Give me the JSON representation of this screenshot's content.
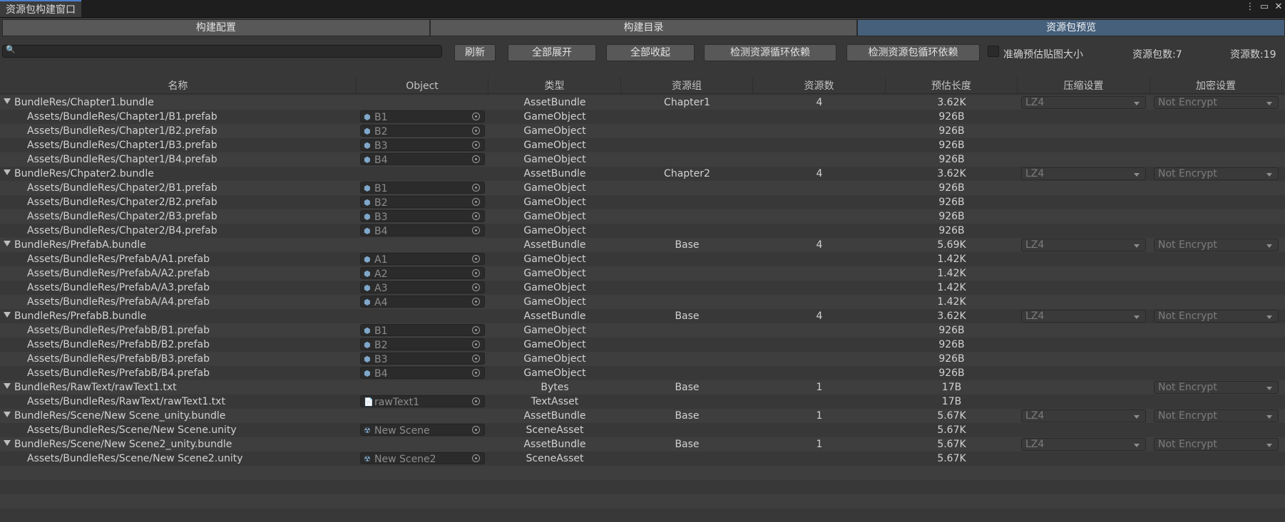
{
  "window": {
    "title": "资源包构建窗口"
  },
  "tabs": [
    {
      "label": "构建配置",
      "active": false
    },
    {
      "label": "构建目录",
      "active": false
    },
    {
      "label": "资源包预览",
      "active": true
    }
  ],
  "toolbar": {
    "search_placeholder": "",
    "refresh": "刷新",
    "expand_all": "全部展开",
    "collapse_all": "全部收起",
    "check_asset_cycle": "检测资源循环依赖",
    "check_bundle_cycle": "检测资源包循环依赖",
    "accurate_texture_size": "准确预估贴图大小",
    "bundle_count": "资源包数:7",
    "asset_count": "资源数:19"
  },
  "columns": {
    "name": "名称",
    "object": "Object",
    "type": "类型",
    "group": "资源组",
    "asset_count": "资源数",
    "size": "预估长度",
    "compression": "压缩设置",
    "encryption": "加密设置"
  },
  "rows": [
    {
      "kind": "bundle",
      "name": "BundleRes/Chapter1.bundle",
      "type": "AssetBundle",
      "group": "Chapter1",
      "count": "4",
      "size": "3.62K",
      "compression": "LZ4",
      "encryption": "Not Encrypt"
    },
    {
      "kind": "asset",
      "name": "Assets/BundleRes/Chapter1/B1.prefab",
      "obj": "B1",
      "obj_icon": "prefab-icon",
      "type": "GameObject",
      "size": "926B"
    },
    {
      "kind": "asset",
      "name": "Assets/BundleRes/Chapter1/B2.prefab",
      "obj": "B2",
      "obj_icon": "prefab-icon",
      "type": "GameObject",
      "size": "926B"
    },
    {
      "kind": "asset",
      "name": "Assets/BundleRes/Chapter1/B3.prefab",
      "obj": "B3",
      "obj_icon": "prefab-icon",
      "type": "GameObject",
      "size": "926B"
    },
    {
      "kind": "asset",
      "name": "Assets/BundleRes/Chapter1/B4.prefab",
      "obj": "B4",
      "obj_icon": "prefab-icon",
      "type": "GameObject",
      "size": "926B"
    },
    {
      "kind": "bundle",
      "name": "BundleRes/Chpater2.bundle",
      "type": "AssetBundle",
      "group": "Chapter2",
      "count": "4",
      "size": "3.62K",
      "compression": "LZ4",
      "encryption": "Not Encrypt"
    },
    {
      "kind": "asset",
      "name": "Assets/BundleRes/Chpater2/B1.prefab",
      "obj": "B1",
      "obj_icon": "prefab-icon",
      "type": "GameObject",
      "size": "926B"
    },
    {
      "kind": "asset",
      "name": "Assets/BundleRes/Chpater2/B2.prefab",
      "obj": "B2",
      "obj_icon": "prefab-icon",
      "type": "GameObject",
      "size": "926B"
    },
    {
      "kind": "asset",
      "name": "Assets/BundleRes/Chpater2/B3.prefab",
      "obj": "B3",
      "obj_icon": "prefab-icon",
      "type": "GameObject",
      "size": "926B"
    },
    {
      "kind": "asset",
      "name": "Assets/BundleRes/Chpater2/B4.prefab",
      "obj": "B4",
      "obj_icon": "prefab-icon",
      "type": "GameObject",
      "size": "926B"
    },
    {
      "kind": "bundle",
      "name": "BundleRes/PrefabA.bundle",
      "type": "AssetBundle",
      "group": "Base",
      "count": "4",
      "size": "5.69K",
      "compression": "LZ4",
      "encryption": "Not Encrypt"
    },
    {
      "kind": "asset",
      "name": "Assets/BundleRes/PrefabA/A1.prefab",
      "obj": "A1",
      "obj_icon": "prefab-icon",
      "type": "GameObject",
      "size": "1.42K"
    },
    {
      "kind": "asset",
      "name": "Assets/BundleRes/PrefabA/A2.prefab",
      "obj": "A2",
      "obj_icon": "prefab-icon",
      "type": "GameObject",
      "size": "1.42K"
    },
    {
      "kind": "asset",
      "name": "Assets/BundleRes/PrefabA/A3.prefab",
      "obj": "A3",
      "obj_icon": "prefab-icon",
      "type": "GameObject",
      "size": "1.42K"
    },
    {
      "kind": "asset",
      "name": "Assets/BundleRes/PrefabA/A4.prefab",
      "obj": "A4",
      "obj_icon": "prefab-icon",
      "type": "GameObject",
      "size": "1.42K"
    },
    {
      "kind": "bundle",
      "name": "BundleRes/PrefabB.bundle",
      "type": "AssetBundle",
      "group": "Base",
      "count": "4",
      "size": "3.62K",
      "compression": "LZ4",
      "encryption": "Not Encrypt"
    },
    {
      "kind": "asset",
      "name": "Assets/BundleRes/PrefabB/B1.prefab",
      "obj": "B1",
      "obj_icon": "prefab-icon",
      "type": "GameObject",
      "size": "926B"
    },
    {
      "kind": "asset",
      "name": "Assets/BundleRes/PrefabB/B2.prefab",
      "obj": "B2",
      "obj_icon": "prefab-icon",
      "type": "GameObject",
      "size": "926B"
    },
    {
      "kind": "asset",
      "name": "Assets/BundleRes/PrefabB/B3.prefab",
      "obj": "B3",
      "obj_icon": "prefab-icon",
      "type": "GameObject",
      "size": "926B"
    },
    {
      "kind": "asset",
      "name": "Assets/BundleRes/PrefabB/B4.prefab",
      "obj": "B4",
      "obj_icon": "prefab-icon",
      "type": "GameObject",
      "size": "926B"
    },
    {
      "kind": "bundle",
      "name": "BundleRes/RawText/rawText1.txt",
      "type": "Bytes",
      "group": "Base",
      "count": "1",
      "size": "17B",
      "compression": "",
      "encryption": "Not Encrypt"
    },
    {
      "kind": "asset",
      "name": "Assets/BundleRes/RawText/rawText1.txt",
      "obj": "rawText1",
      "obj_icon": "text-file-icon",
      "type": "TextAsset",
      "size": "17B"
    },
    {
      "kind": "bundle",
      "name": "BundleRes/Scene/New Scene_unity.bundle",
      "type": "AssetBundle",
      "group": "Base",
      "count": "1",
      "size": "5.67K",
      "compression": "LZ4",
      "encryption": "Not Encrypt"
    },
    {
      "kind": "asset",
      "name": "Assets/BundleRes/Scene/New Scene.unity",
      "obj": "New Scene",
      "obj_icon": "scene-icon",
      "type": "SceneAsset",
      "size": "5.67K"
    },
    {
      "kind": "bundle",
      "name": "BundleRes/Scene/New Scene2_unity.bundle",
      "type": "AssetBundle",
      "group": "Base",
      "count": "1",
      "size": "5.67K",
      "compression": "LZ4",
      "encryption": "Not Encrypt"
    },
    {
      "kind": "asset",
      "name": "Assets/BundleRes/Scene/New Scene2.unity",
      "obj": "New Scene2",
      "obj_icon": "scene-icon",
      "type": "SceneAsset",
      "size": "5.67K"
    }
  ],
  "colors": {
    "background": "#383838",
    "row_alt": "#3e3e3e",
    "active_tab": "#46607c",
    "button": "#585858",
    "text": "#d2d2d2"
  }
}
